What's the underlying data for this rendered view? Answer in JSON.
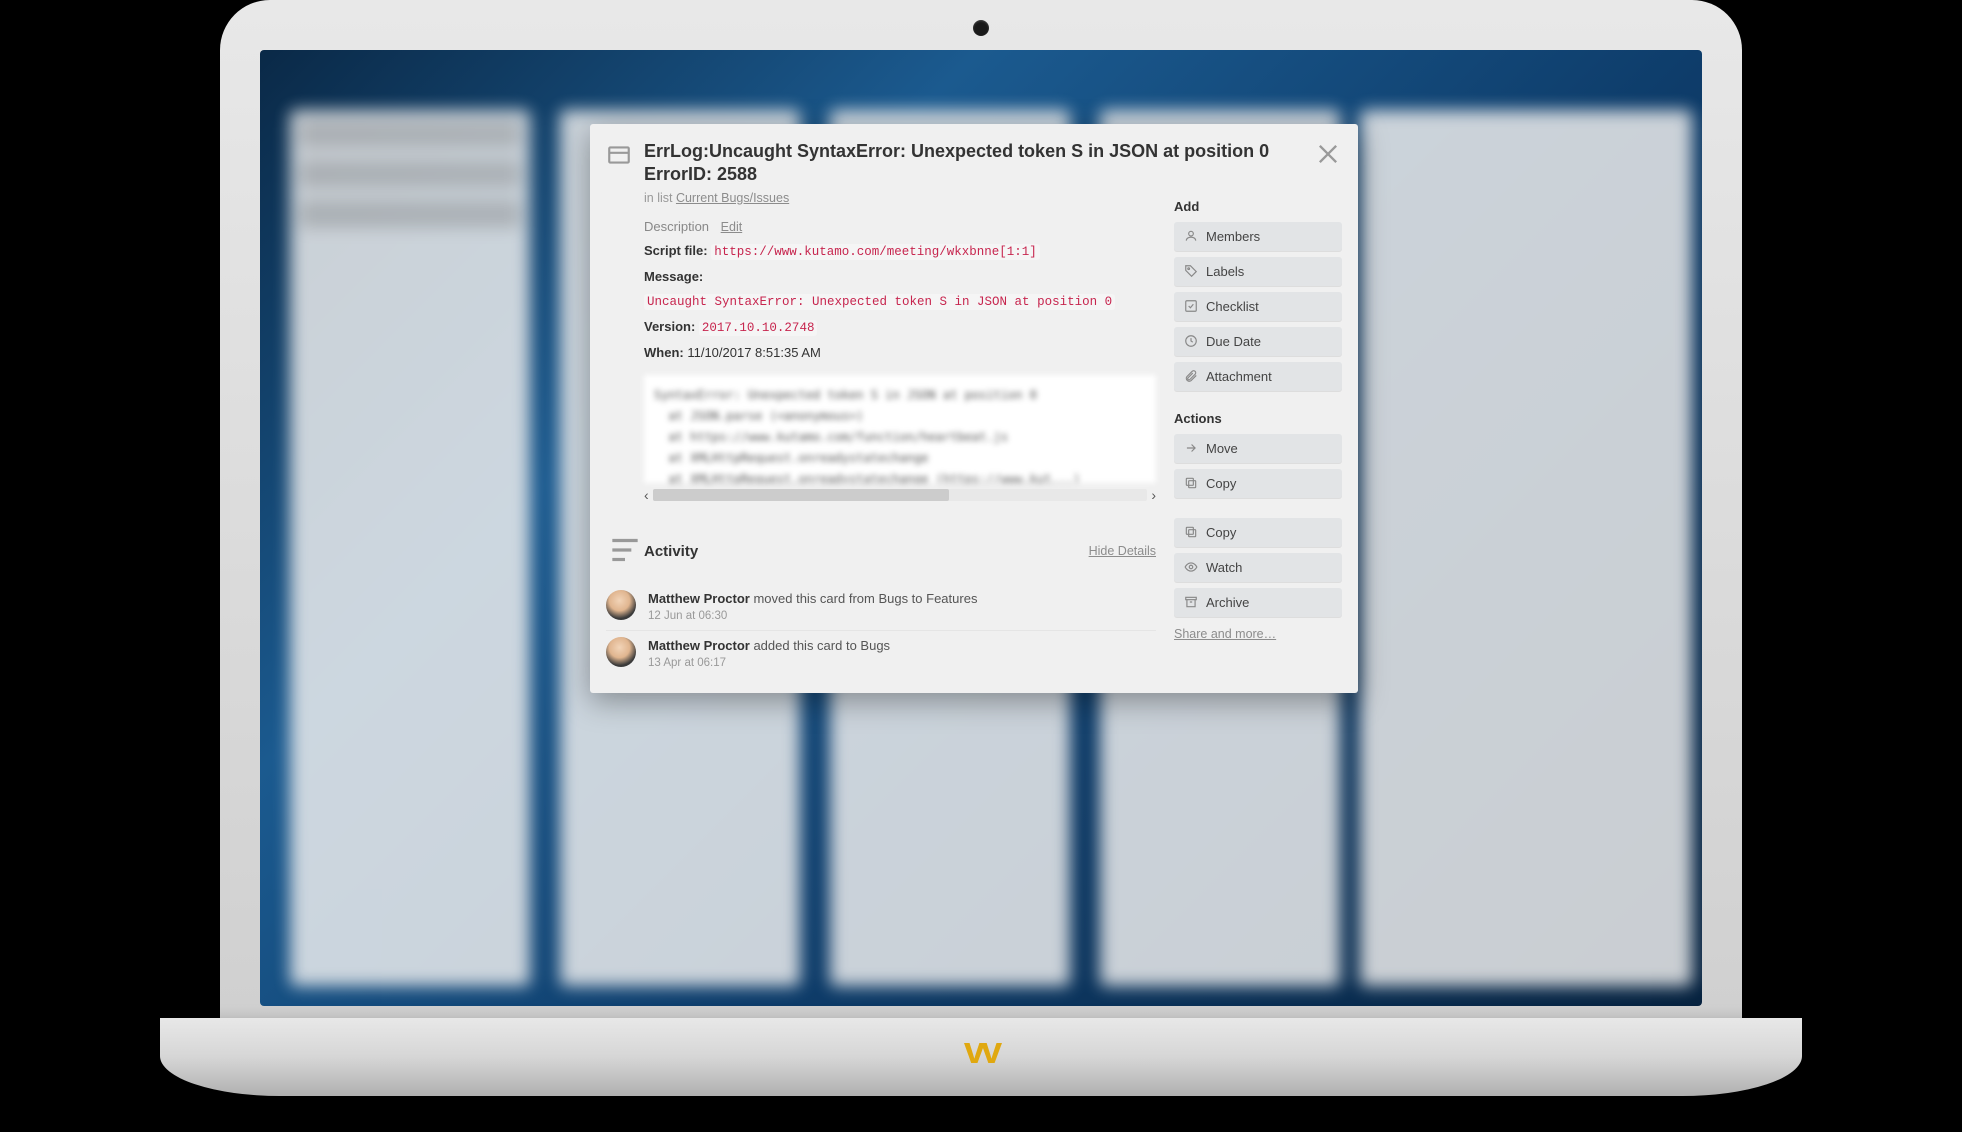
{
  "card": {
    "title": "ErrLog:Uncaught SyntaxError: Unexpected token S in JSON at position 0 ErrorID: 2588",
    "list_prefix": "in list ",
    "list_name": "Current Bugs/Issues",
    "description_label": "Description",
    "edit_label": "Edit",
    "fields": {
      "script_file_label": "Script file:",
      "script_file": "https://www.kutamo.com/meeting/wkxbnne[1:1]",
      "message_label": "Message:",
      "message": "Uncaught SyntaxError: Unexpected token S in JSON at position 0",
      "version_label": "Version:",
      "version": "2017.10.10.2748",
      "when_label": "When:",
      "when": "11/10/2017 8:51:35 AM"
    }
  },
  "activity": {
    "heading": "Activity",
    "hide_details": "Hide Details",
    "items": [
      {
        "user": "Matthew Proctor",
        "action": " moved this card from Bugs to Features",
        "time": "12 Jun at 06:30"
      },
      {
        "user": "Matthew Proctor",
        "action": " added this card to Bugs",
        "time": "13 Apr at 06:17"
      }
    ]
  },
  "sidebar": {
    "add_heading": "Add",
    "add": [
      {
        "icon": "👤",
        "label": "Members"
      },
      {
        "icon": "🏷",
        "label": "Labels"
      },
      {
        "icon": "☑",
        "label": "Checklist"
      },
      {
        "icon": "🕒",
        "label": "Due Date"
      },
      {
        "icon": "📎",
        "label": "Attachment"
      }
    ],
    "actions_heading": "Actions",
    "actions": [
      {
        "icon": "→",
        "label": "Move"
      },
      {
        "icon": "⎘",
        "label": "Copy"
      }
    ],
    "extras": [
      {
        "icon": "⎘",
        "label": "Copy"
      },
      {
        "icon": "👁",
        "label": "Watch"
      },
      {
        "icon": "🗄",
        "label": "Archive"
      }
    ],
    "share": "Share and more…"
  }
}
